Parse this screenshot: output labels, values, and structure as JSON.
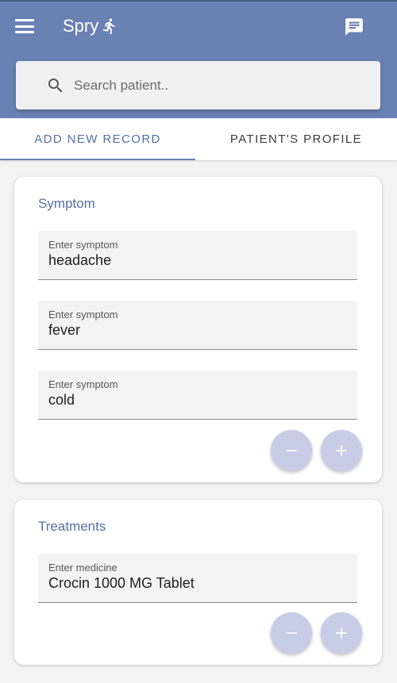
{
  "app": {
    "title": "Spry"
  },
  "search": {
    "placeholder": "Search patient..",
    "value": ""
  },
  "tabs": [
    {
      "label": "ADD NEW RECORD",
      "active": true
    },
    {
      "label": "PATIENT'S PROFILE",
      "active": false
    }
  ],
  "symptom_section": {
    "title": "Symptom",
    "fields": [
      {
        "label": "Enter symptom",
        "value": "headache"
      },
      {
        "label": "Enter symptom",
        "value": "fever"
      },
      {
        "label": "Enter symptom",
        "value": "cold"
      }
    ]
  },
  "treatment_section": {
    "title": "Treatments",
    "fields": [
      {
        "label": "Enter medicine",
        "value": "Crocin 1000 MG Tablet"
      }
    ]
  },
  "icons": {
    "menu": "menu-icon",
    "logo": "running-person-icon",
    "chat": "chat-icon",
    "search": "search-icon",
    "remove": "minus-icon",
    "add": "plus-icon"
  },
  "colors": {
    "primary": "#6a81b3",
    "accent_text": "#5670a6",
    "fab": "#c7cde6"
  }
}
